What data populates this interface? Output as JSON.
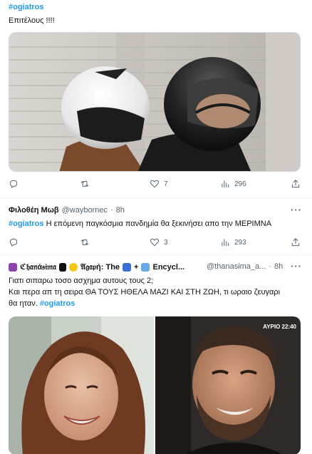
{
  "tweet1": {
    "hashtag": "#ogiatros",
    "text": "Επιτέλους !!!!",
    "stats": {
      "replies": "",
      "retweets": "",
      "likes": "7",
      "views": "296"
    }
  },
  "tweet2": {
    "name": "Φιλοθέη Μωβ",
    "handle": "@waybornec",
    "dot": "·",
    "time": "8h",
    "more": "···",
    "hashtag": "#ogiatros",
    "text": " Η επόμενη παγκόσμια πανδημία θα ξεκινήσει απο την ΜΕΡΙΜΝΑ",
    "stats": {
      "replies": "",
      "retweets": "",
      "likes": "3",
      "views": "293"
    }
  },
  "tweet3": {
    "name_part1": "ℭ𝔥𝔞𝔫ά𝔰𝔦𝔪𝔞",
    "name_part2": "𝔄𝔤𝔞𝔭ή: The",
    "name_part3": "Encycl...",
    "handle": "@thanasima_a...",
    "dot": "·",
    "time": "8h",
    "more": "···",
    "line1": "Γιατι σιπαρω τοσο ασχημα αυτους τους 2;",
    "line2": "Και περα απ τη σειρα ΘΑ ΤΟΥΣ ΗΘΕΛΑ ΜΑΖΙ ΚΑΙ ΣΤΗ ΖΩΗ, τι ωραιο ζευγαρι",
    "line3": "θα ηταν. ",
    "hashtag": "#ogiatros",
    "overlay": "ΑΥΡΙΟ 22:40"
  },
  "colors": {
    "accent": "#1d9bf0",
    "muted": "#536471"
  },
  "icons": [
    "reply-icon",
    "retweet-icon",
    "like-icon",
    "views-icon",
    "share-icon",
    "more-icon"
  ]
}
